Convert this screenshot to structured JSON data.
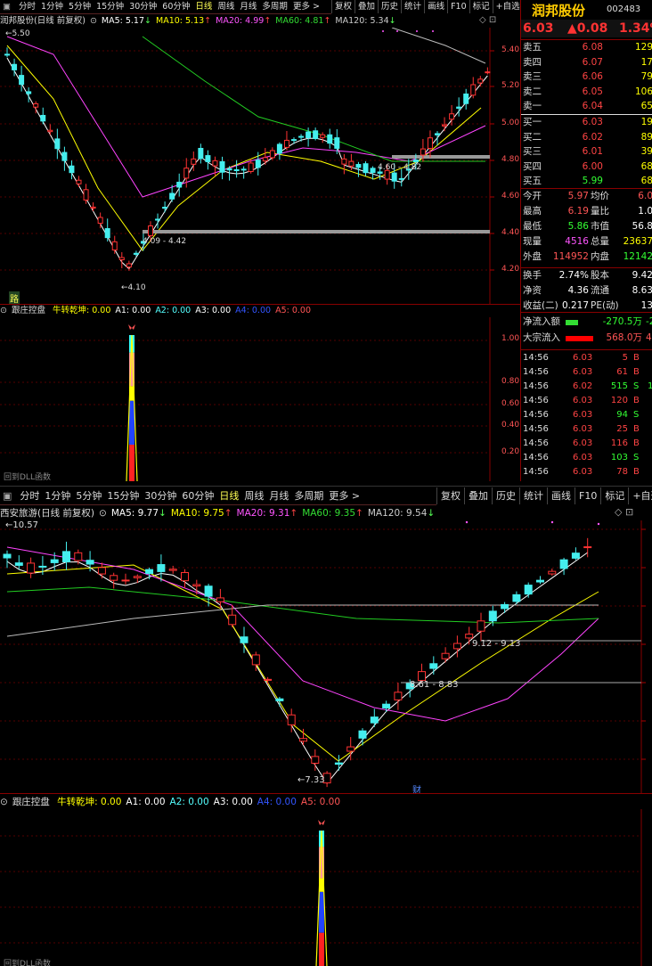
{
  "top": {
    "tabs": [
      "分时",
      "1分钟",
      "5分钟",
      "15分钟",
      "30分钟",
      "60分钟",
      "日线",
      "周线",
      "月线",
      "多周期",
      "更多 >"
    ],
    "active_tab": "日线",
    "toolbar": [
      "复权",
      "叠加",
      "历史",
      "统计",
      "画线",
      "F10",
      "标记",
      "+自选",
      "返回"
    ],
    "stock_title": "润邦股份(日线 前复权)",
    "ma": [
      {
        "label": "MA5: 5.17",
        "arrow": "↓",
        "color": "#ffffff"
      },
      {
        "label": "MA10: 5.13",
        "arrow": "↑",
        "color": "#ffff00"
      },
      {
        "label": "MA20: 4.99",
        "arrow": "↑",
        "color": "#ff55ff"
      },
      {
        "label": "MA60: 4.81",
        "arrow": "↑",
        "color": "#33dd33"
      },
      {
        "label": "MA120: 5.34",
        "arrow": "↓",
        "color": "#cccccc"
      }
    ],
    "price_axis": [
      "5.40",
      "5.20",
      "5.00",
      "4.80",
      "4.60",
      "4.40",
      "4.20"
    ],
    "annotations": {
      "high": "5.50",
      "low": "4.10",
      "range1": "4.09 - 4.42",
      "range2": "4.60 - 4.82"
    },
    "bottom_marker": "路",
    "indicator": {
      "name": "跟庄控盘",
      "items": [
        {
          "t": "牛转乾坤: 0.00",
          "c": "#ffff00"
        },
        {
          "t": "A1: 0.00",
          "c": "#ffffff"
        },
        {
          "t": "A2: 0.00",
          "c": "#55ffff"
        },
        {
          "t": "A3: 0.00",
          "c": "#ffffff"
        },
        {
          "t": "A4: 0.00",
          "c": "#3355ff"
        },
        {
          "t": "A5: 0.00",
          "c": "#ff5555"
        }
      ]
    },
    "ind_axis": [
      "1.00",
      "0.80",
      "0.60",
      "0.40",
      "0.20"
    ],
    "ind_bottom_text": "回到DLL函数",
    "quote": {
      "name": "润邦股份",
      "code": "002483",
      "price": "6.03",
      "change": "▲0.08",
      "pct": "1.34%",
      "asks": [
        {
          "l": "卖五",
          "p": "6.08",
          "v": "129"
        },
        {
          "l": "卖四",
          "p": "6.07",
          "v": "17"
        },
        {
          "l": "卖三",
          "p": "6.06",
          "v": "79"
        },
        {
          "l": "卖二",
          "p": "6.05",
          "v": "106"
        },
        {
          "l": "卖一",
          "p": "6.04",
          "v": "65"
        }
      ],
      "bids": [
        {
          "l": "买一",
          "p": "6.03",
          "v": "19"
        },
        {
          "l": "买二",
          "p": "6.02",
          "v": "89"
        },
        {
          "l": "买三",
          "p": "6.01",
          "v": "39"
        },
        {
          "l": "买四",
          "p": "6.00",
          "v": "68"
        },
        {
          "l": "买五",
          "p": "5.99",
          "v": "68"
        }
      ],
      "stats": [
        [
          {
            "l": "今开",
            "v": "5.97",
            "c": "#ff5555"
          },
          {
            "l": "均价",
            "v": "6.0",
            "c": "#ff5555"
          }
        ],
        [
          {
            "l": "最高",
            "v": "6.19",
            "c": "#ff5555"
          },
          {
            "l": "量比",
            "v": "1.0",
            "c": "#ffffff"
          }
        ],
        [
          {
            "l": "最低",
            "v": "5.86",
            "c": "#33ff33"
          },
          {
            "l": "市值",
            "v": "56.8",
            "c": "#ffffff"
          }
        ],
        [
          {
            "l": "现量",
            "v": "4516",
            "c": "#ff55ff"
          },
          {
            "l": "总量",
            "v": "23637",
            "c": "#ffff00"
          }
        ],
        [
          {
            "l": "外盘",
            "v": "114952",
            "c": "#ff5555"
          },
          {
            "l": "内盘",
            "v": "12142",
            "c": "#33ff33"
          }
        ]
      ],
      "stats2": [
        [
          {
            "l": "换手",
            "v": "2.74%",
            "c": "#ffffff"
          },
          {
            "l": "股本",
            "v": "9.42",
            "c": "#ffffff"
          }
        ],
        [
          {
            "l": "净资",
            "v": "4.36",
            "c": "#ffffff"
          },
          {
            "l": "流通",
            "v": "8.63",
            "c": "#ffffff"
          }
        ],
        [
          {
            "l": "收益(二)",
            "v": "0.217",
            "c": "#ffffff"
          },
          {
            "l": "PE(动)",
            "v": "13",
            "c": "#ffffff"
          }
        ]
      ],
      "flow": [
        {
          "l": "净流入额",
          "v": "-270.5万",
          "c": "#33ff33",
          "bar": 0.28,
          "bc": "#33dd33",
          "x": "-2"
        },
        {
          "l": "大宗流入",
          "v": "568.0万",
          "c": "#ff5555",
          "bar": 0.62,
          "bc": "#ff0000",
          "x": "4"
        }
      ],
      "ticks": [
        {
          "t": "14:56",
          "p": "6.03",
          "v": "5",
          "s": "B"
        },
        {
          "t": "14:56",
          "p": "6.03",
          "v": "61",
          "s": "B"
        },
        {
          "t": "14:56",
          "p": "6.02",
          "v": "515",
          "s": "S",
          "x": "1"
        },
        {
          "t": "14:56",
          "p": "6.03",
          "v": "120",
          "s": "B"
        },
        {
          "t": "14:56",
          "p": "6.03",
          "v": "94",
          "s": "S"
        },
        {
          "t": "14:56",
          "p": "6.03",
          "v": "25",
          "s": "B"
        },
        {
          "t": "14:56",
          "p": "6.03",
          "v": "116",
          "s": "B"
        },
        {
          "t": "14:56",
          "p": "6.03",
          "v": "103",
          "s": "S"
        },
        {
          "t": "14:56",
          "p": "6.03",
          "v": "78",
          "s": "B"
        }
      ]
    }
  },
  "bottom": {
    "tabs": [
      "分时",
      "1分钟",
      "5分钟",
      "15分钟",
      "30分钟",
      "60分钟",
      "日线",
      "周线",
      "月线",
      "多周期",
      "更多 >"
    ],
    "active_tab": "日线",
    "toolbar": [
      "复权",
      "叠加",
      "历史",
      "统计",
      "画线",
      "F10",
      "标记",
      "+自选"
    ],
    "stock_title": "西安旅游(日线 前复权)",
    "ma": [
      {
        "label": "MA5: 9.77",
        "arrow": "↓",
        "color": "#ffffff"
      },
      {
        "label": "MA10: 9.75",
        "arrow": "↑",
        "color": "#ffff00"
      },
      {
        "label": "MA20: 9.31",
        "arrow": "↑",
        "color": "#ff55ff"
      },
      {
        "label": "MA60: 9.35",
        "arrow": "↑",
        "color": "#33dd33"
      },
      {
        "label": "MA120: 9.54",
        "arrow": "↓",
        "color": "#cccccc"
      }
    ],
    "annotations": {
      "high": "10.57",
      "low": "7.33",
      "range1": "8.61 - 8.83",
      "range2": "9.12 - 9.13",
      "cai": "财"
    },
    "indicator": {
      "name": "跟庄控盘",
      "items": [
        {
          "t": "牛转乾坤: 0.00",
          "c": "#ffff00"
        },
        {
          "t": "A1: 0.00",
          "c": "#ffffff"
        },
        {
          "t": "A2: 0.00",
          "c": "#55ffff"
        },
        {
          "t": "A3: 0.00",
          "c": "#ffffff"
        },
        {
          "t": "A4: 0.00",
          "c": "#3355ff"
        },
        {
          "t": "A5: 0.00",
          "c": "#ff5555"
        }
      ]
    },
    "ind_bottom_text": "回到DLL函数"
  }
}
